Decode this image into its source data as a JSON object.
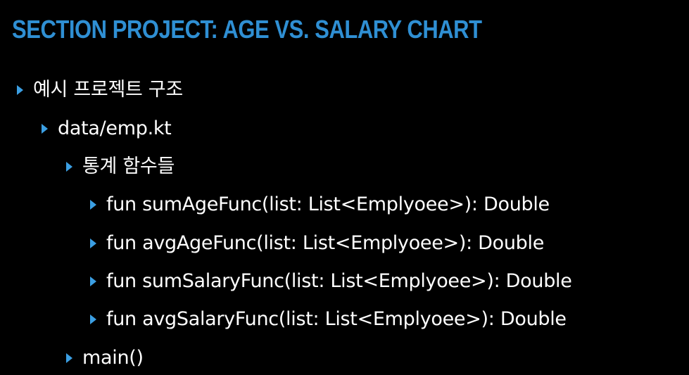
{
  "slide": {
    "title": "SECTION PROJECT: AGE VS. SALARY CHART",
    "accent_color": "#2f8fd3",
    "bullet_icon": "triangle-right-icon",
    "items": [
      {
        "level": 1,
        "text": "예시 프로젝트 구조"
      },
      {
        "level": 2,
        "text": "data/emp.kt"
      },
      {
        "level": 3,
        "text": "통계 함수들"
      },
      {
        "level": 4,
        "text": "fun sumAgeFunc(list: List<Emplyoee>): Double"
      },
      {
        "level": 4,
        "text": "fun avgAgeFunc(list: List<Emplyoee>): Double"
      },
      {
        "level": 4,
        "text": "fun sumSalaryFunc(list: List<Emplyoee>): Double"
      },
      {
        "level": 4,
        "text": "fun avgSalaryFunc(list: List<Emplyoee>): Double"
      },
      {
        "level": 3,
        "text": "main()"
      }
    ]
  }
}
